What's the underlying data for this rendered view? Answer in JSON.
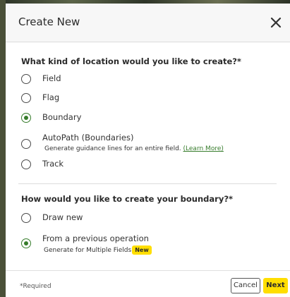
{
  "dialog": {
    "title": "Create New",
    "close_icon": "close-icon"
  },
  "location_question": {
    "label": "What kind of location would you like to create?*",
    "options": [
      {
        "label": "Field",
        "selected": false
      },
      {
        "label": "Flag",
        "selected": false
      },
      {
        "label": "Boundary",
        "selected": true
      },
      {
        "label": "AutoPath (Boundaries)",
        "selected": false,
        "sub_text": "Generate guidance lines for an entire field.",
        "link_text": "(Learn More)"
      },
      {
        "label": "Track",
        "selected": false
      }
    ]
  },
  "boundary_question": {
    "label": "How would you like to create your boundary?*",
    "options": [
      {
        "label": "Draw new",
        "selected": false
      },
      {
        "label": "From a previous operation",
        "selected": true,
        "sub_text": "Generate for Multiple Fields",
        "badge": "New"
      }
    ]
  },
  "footer": {
    "required_note": "*Required",
    "cancel_label": "Cancel",
    "next_label": "Next"
  },
  "colors": {
    "accent_green": "#367c2b",
    "badge_yellow": "#ffde00"
  }
}
